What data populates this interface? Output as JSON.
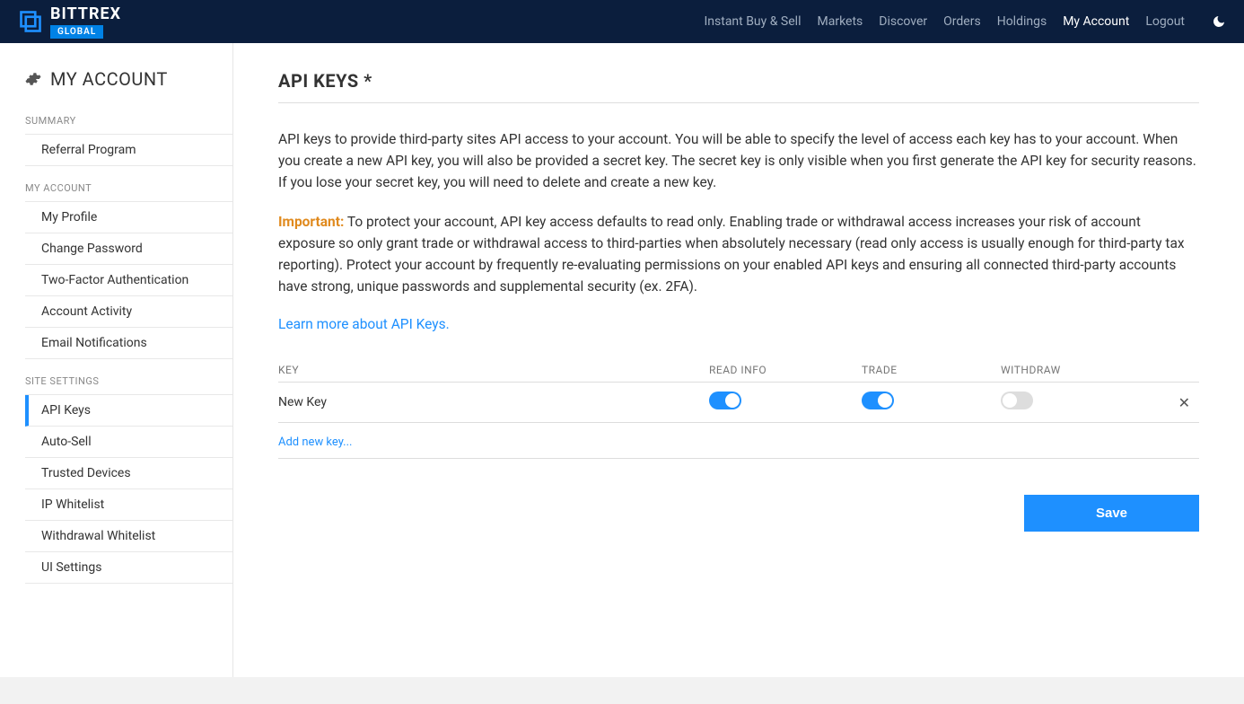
{
  "brand": {
    "name": "BITTREX",
    "badge": "GLOBAL"
  },
  "nav": {
    "instant": "Instant Buy & Sell",
    "markets": "Markets",
    "discover": "Discover",
    "orders": "Orders",
    "holdings": "Holdings",
    "account": "My Account",
    "logout": "Logout"
  },
  "sidebar": {
    "title": "MY ACCOUNT",
    "sections": {
      "summary": {
        "label": "SUMMARY",
        "items": {
          "referral": "Referral Program"
        }
      },
      "account": {
        "label": "MY ACCOUNT",
        "items": {
          "profile": "My Profile",
          "password": "Change Password",
          "twofa": "Two-Factor Authentication",
          "activity": "Account Activity",
          "email": "Email Notifications"
        }
      },
      "site": {
        "label": "SITE SETTINGS",
        "items": {
          "api": "API Keys",
          "autosell": "Auto-Sell",
          "trusted": "Trusted Devices",
          "ip": "IP Whitelist",
          "withdrawal": "Withdrawal Whitelist",
          "ui": "UI Settings"
        }
      }
    }
  },
  "page": {
    "title": "API KEYS *",
    "intro1": "API keys to provide third-party sites API access to your account. You will be able to specify the level of access each key has to your account. When you create a new API key, you will also be provided a secret key. The secret key is only visible when you first generate the API key for security reasons. If you lose your secret key, you will need to delete and create a new key.",
    "important_label": "Important:",
    "intro2": " To protect your account, API key access defaults to read only. Enabling trade or withdrawal access increases your risk of account exposure so only grant trade or withdrawal access to third-parties when absolutely necessary (read only access is usually enough for third-party tax reporting). Protect your account by frequently re-evaluating permissions on your enabled API keys and ensuring all connected third-party accounts have strong, unique passwords and supplemental security (ex. 2FA).",
    "learn_more": "Learn more about API Keys."
  },
  "table": {
    "headers": {
      "key": "KEY",
      "read": "READ INFO",
      "trade": "TRADE",
      "withdraw": "WITHDRAW"
    },
    "rows": [
      {
        "key": "New Key",
        "read": true,
        "trade": true,
        "withdraw": false
      }
    ],
    "add_label": "Add new key..."
  },
  "buttons": {
    "save": "Save"
  }
}
